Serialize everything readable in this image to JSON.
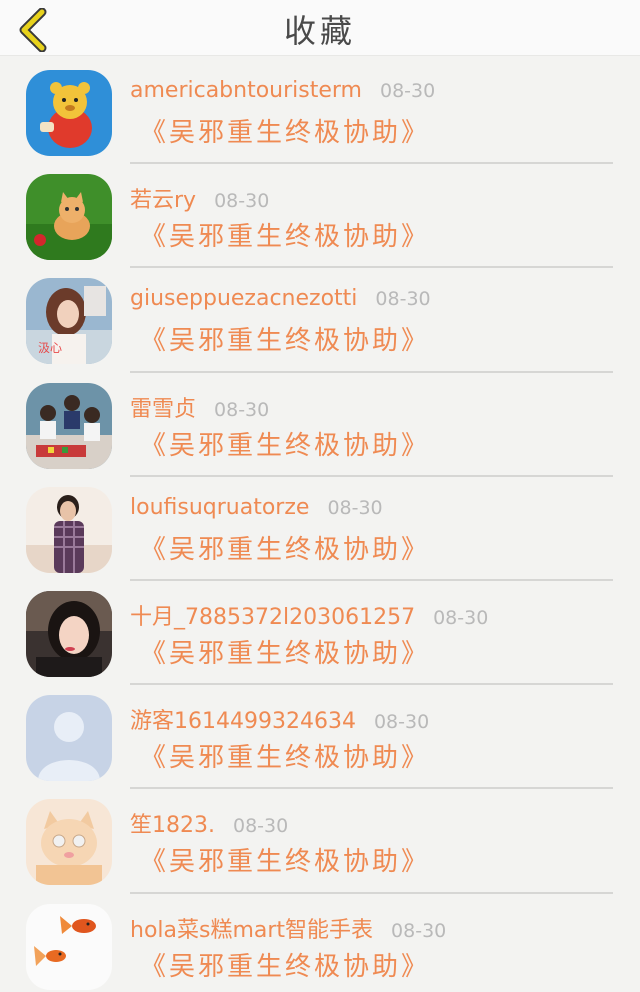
{
  "header": {
    "title": "收藏",
    "back_icon": "chevron-left-icon",
    "accent": "#e8d21c"
  },
  "colors": {
    "name": "#ef8a52",
    "time": "#b9b9b9",
    "background": "#f3f3f1"
  },
  "items": [
    {
      "name": "americabntouristerm",
      "time": "08-30",
      "message": "《吴邪重生终极协助》",
      "avatar": "cartoon-bear"
    },
    {
      "name": "若云ry",
      "time": "08-30",
      "message": "《吴邪重生终极协助》",
      "avatar": "kitten-on-grass"
    },
    {
      "name": "giuseppuezacnezotti",
      "time": "08-30",
      "message": "《吴邪重生终极协助》",
      "avatar": "girl-photo"
    },
    {
      "name": "雷雪贞",
      "time": "08-30",
      "message": "《吴邪重生终极协助》",
      "avatar": "group-photo"
    },
    {
      "name": "loufisuqruatorze",
      "time": "08-30",
      "message": "《吴邪重生终极协助》",
      "avatar": "man-plaid-shirt"
    },
    {
      "name": "十月_7885372l203061257",
      "time": "08-30",
      "message": "《吴邪重生终极协助》",
      "avatar": "woman-selfie"
    },
    {
      "name": "游客1614499324634",
      "time": "08-30",
      "message": "《吴邪重生终极协助》",
      "avatar": "default-user"
    },
    {
      "name": "笙1823.",
      "time": "08-30",
      "message": "《吴邪重生终极协助》",
      "avatar": "cartoon-cat"
    },
    {
      "name": "hola菜s糕mart智能手表",
      "time": "08-30",
      "message": "《吴邪重生终极协助》",
      "avatar": "goldfish"
    }
  ]
}
